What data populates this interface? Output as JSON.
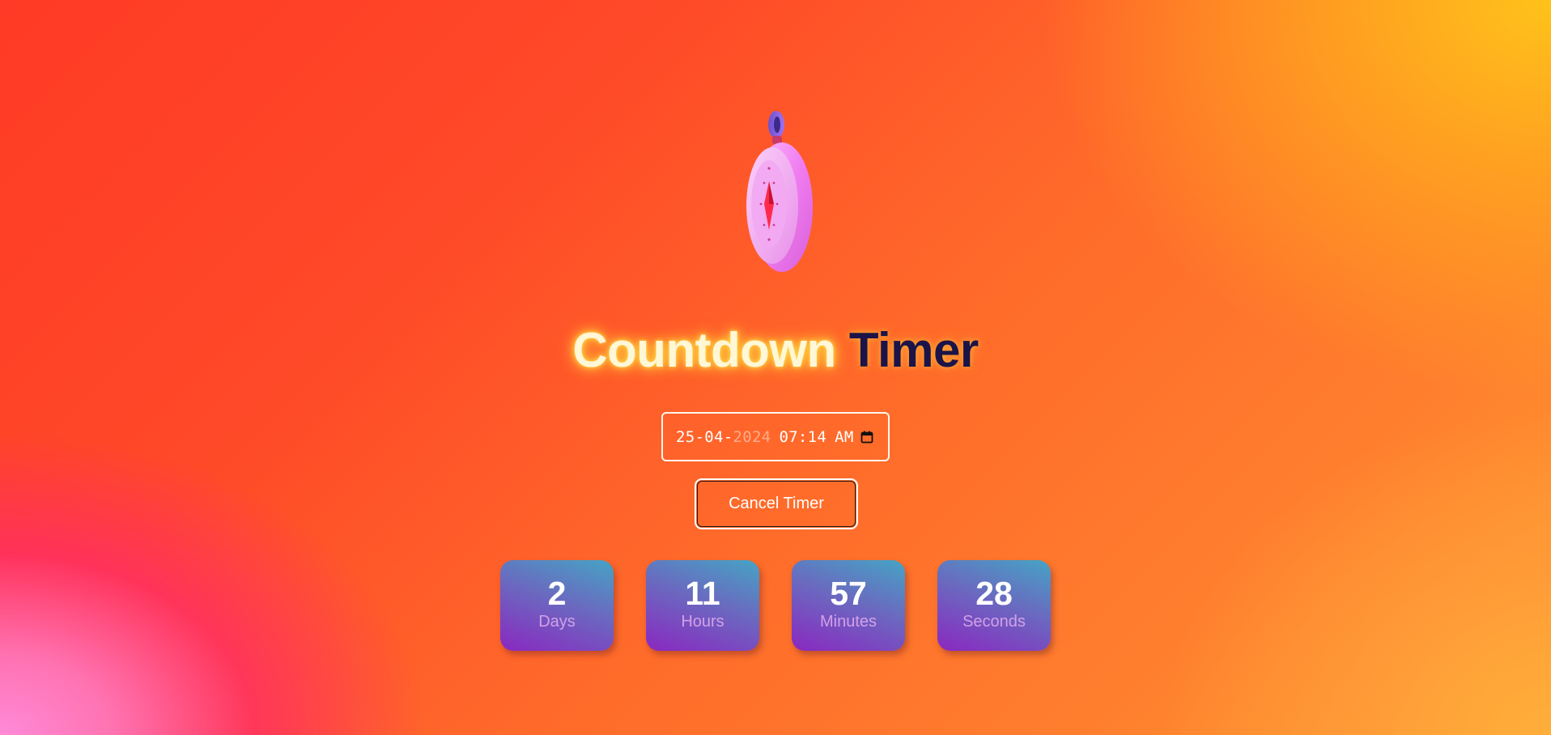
{
  "icon": "stopwatch-icon",
  "title": {
    "word_a": "Countdown",
    "word_b": "Timer"
  },
  "datetime_input": {
    "day": "25",
    "month": "04",
    "year": "2024",
    "hour": "07",
    "minute": "14",
    "meridiem": "AM",
    "icon": "calendar-icon"
  },
  "cancel_button": {
    "label": "Cancel Timer"
  },
  "countdown": [
    {
      "value": "2",
      "label": "Days"
    },
    {
      "value": "11",
      "label": "Hours"
    },
    {
      "value": "57",
      "label": "Minutes"
    },
    {
      "value": "28",
      "label": "Seconds"
    }
  ],
  "colors": {
    "title_a": "#fff7d6",
    "title_b": "#1c1448",
    "tile_top": "#45a4c4",
    "tile_bottom": "#8a28c0"
  }
}
